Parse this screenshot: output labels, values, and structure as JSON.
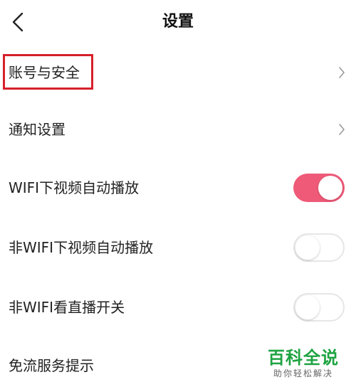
{
  "header": {
    "title": "设置",
    "back_icon": "chevron-left-icon"
  },
  "rows": [
    {
      "label": "账号与安全",
      "control": "chevron",
      "highlighted": true
    },
    {
      "label": "通知设置",
      "control": "chevron"
    },
    {
      "label": "WIFI下视频自动播放",
      "control": "toggle",
      "toggle_state": "on"
    },
    {
      "label": "非WIFI下视频自动播放",
      "control": "toggle",
      "toggle_state": "off"
    },
    {
      "label": "非WIFI看直播开关",
      "control": "toggle",
      "toggle_state": "off"
    },
    {
      "label": "免流服务提示",
      "control": "none"
    }
  ],
  "watermark": {
    "main": "百科全说",
    "sub": "助你轻松解决"
  },
  "colors": {
    "toggle_on": "#ef5a78",
    "highlight_border": "#d6202a",
    "watermark_green": "#1fa342"
  }
}
